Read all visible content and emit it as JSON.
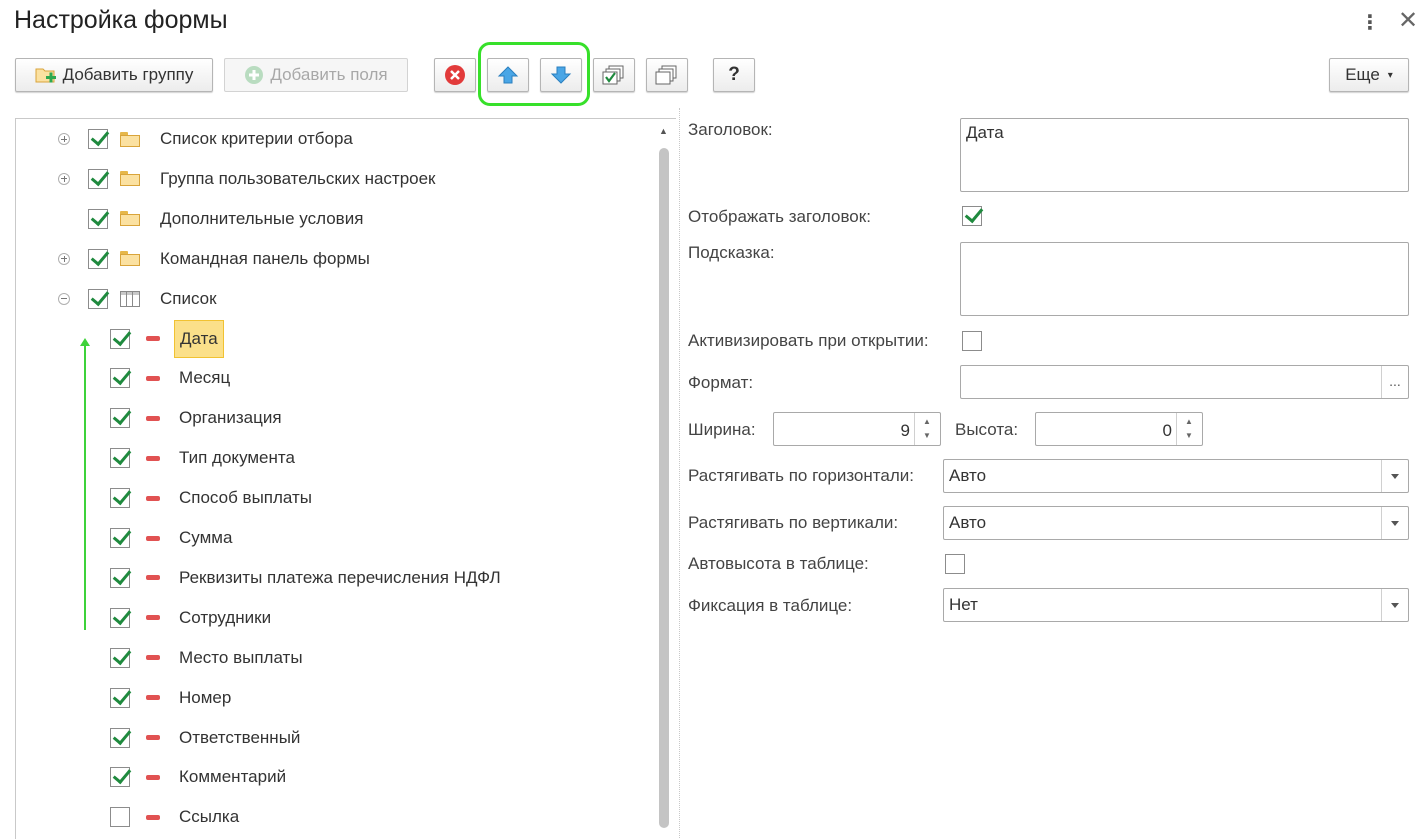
{
  "window": {
    "title": "Настройка формы",
    "more_icon": "⋮",
    "close_icon": "✕"
  },
  "toolbar": {
    "add_group_label": "Добавить группу",
    "add_fields_label": "Добавить поля",
    "help_label": "?",
    "more_label": "Еще"
  },
  "tree": {
    "groups": [
      {
        "label": "Список критерии отбора",
        "checked": true,
        "expander": "plus",
        "icon": "folder-icon"
      },
      {
        "label": "Группа пользовательских настроек",
        "checked": true,
        "expander": "plus",
        "icon": "folder-icon"
      },
      {
        "label": "Дополнительные условия",
        "checked": true,
        "expander": "none",
        "icon": "folder-icon"
      },
      {
        "label": "Командная панель формы",
        "checked": true,
        "expander": "plus",
        "icon": "folder-icon"
      },
      {
        "label": "Список",
        "checked": true,
        "expander": "minus",
        "icon": "table-icon"
      }
    ],
    "fields": [
      {
        "label": "Дата",
        "checked": true,
        "selected": true
      },
      {
        "label": "Месяц",
        "checked": true
      },
      {
        "label": "Организация",
        "checked": true
      },
      {
        "label": "Тип документа",
        "checked": true
      },
      {
        "label": "Способ выплаты",
        "checked": true
      },
      {
        "label": "Сумма",
        "checked": true
      },
      {
        "label": "Реквизиты платежа перечисления НДФЛ",
        "checked": true
      },
      {
        "label": "Сотрудники",
        "checked": true
      },
      {
        "label": "Место выплаты",
        "checked": true
      },
      {
        "label": "Номер",
        "checked": true
      },
      {
        "label": "Ответственный",
        "checked": true
      },
      {
        "label": "Комментарий",
        "checked": true
      },
      {
        "label": "Ссылка",
        "checked": false
      }
    ]
  },
  "properties": {
    "title_label": "Заголовок:",
    "title_value": "Дата",
    "show_title_label": "Отображать заголовок:",
    "show_title_checked": true,
    "hint_label": "Подсказка:",
    "hint_value": "",
    "activate_label": "Активизировать при открытии:",
    "activate_checked": false,
    "format_label": "Формат:",
    "format_value": "",
    "format_button": "...",
    "width_label": "Ширина:",
    "width_value": "9",
    "height_label": "Высота:",
    "height_value": "0",
    "stretch_h_label": "Растягивать по горизонтали:",
    "stretch_h_value": "Авто",
    "stretch_v_label": "Растягивать по вертикали:",
    "stretch_v_value": "Авто",
    "autoheight_label": "Автовысота в таблице:",
    "autoheight_checked": false,
    "fix_label": "Фиксация в таблице:",
    "fix_value": "Нет"
  },
  "colors": {
    "highlight": "#37e02a",
    "selection": "#fbe08a",
    "check": "#1f8a3e",
    "minus": "#e15252"
  }
}
